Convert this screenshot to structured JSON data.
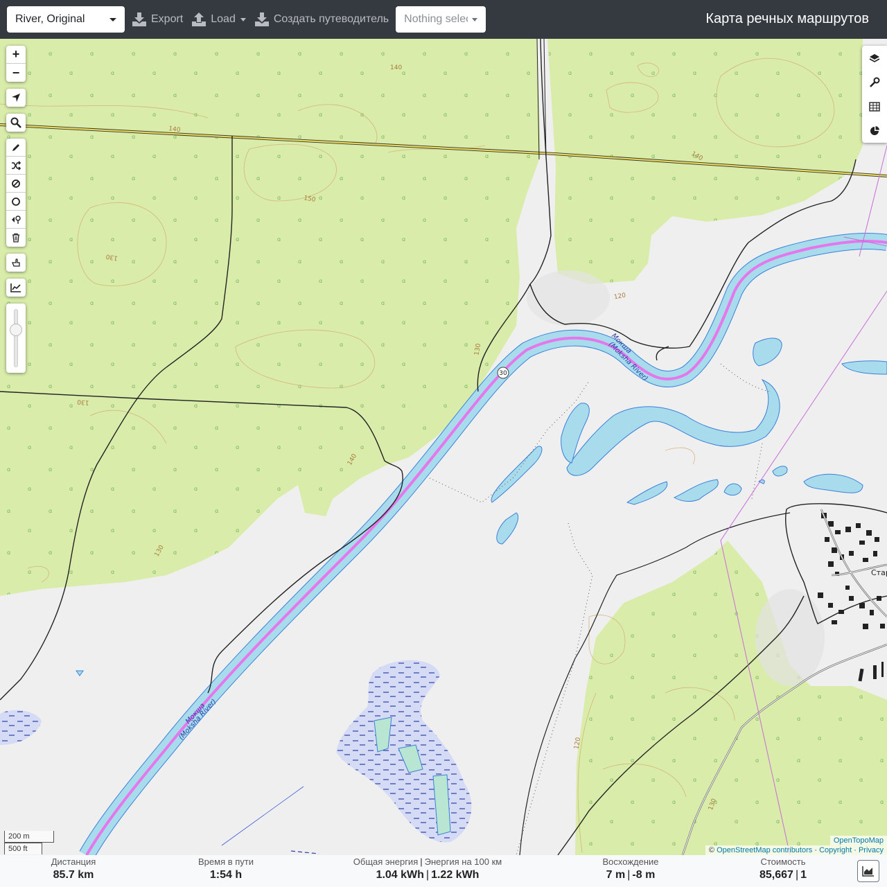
{
  "topbar": {
    "profile_value": "River, Original",
    "export_label": "Export",
    "load_label": "Load",
    "guide_label": "Создать путеводитель",
    "nothing_selected": "Nothing selected",
    "app_title": "Карта речных маршрутов"
  },
  "map": {
    "river_label_upper": "Мокша",
    "river_label_upper_sub": "(Moksha River)",
    "river_label_lower": "Мокша",
    "river_label_lower_sub": "(Moksha River)",
    "route_marker": "30",
    "contours": [
      "140",
      "140",
      "150",
      "130",
      "130",
      "130",
      "140",
      "130",
      "120",
      "120",
      "130",
      "140"
    ],
    "settlement_label": "Стар",
    "colors": {
      "forest": "#d9ecaa",
      "water": "#a8dcec",
      "route": "#e676ec",
      "river_edge": "#3b7fd9",
      "road_major": "#ead85a"
    }
  },
  "controls": {
    "zoom_in": "+",
    "zoom_out": "−"
  },
  "scale": {
    "metric": "200 m",
    "imperial": "500 ft"
  },
  "attribution": {
    "provider": "OpenTopoMap",
    "copyright_prefix": "©",
    "osm": "OpenStreetMap contributors",
    "copyright": "Copyright",
    "privacy": "Privacy",
    "sep": "·"
  },
  "stats": {
    "distance_label": "Дистанция",
    "distance_value": "85.7 km",
    "time_label": "Время в пути",
    "time_value": "1:54 h",
    "energy_label": "Общая энергия",
    "energy_per_label": "Энергия на 100 км",
    "energy_value": "1.04 kWh",
    "energy_per_value": "1.22 kWh",
    "ascent_label": "Восхождение",
    "ascent_value": "7 m",
    "descent_value": "-8 m",
    "cost_label": "Стоимость",
    "cost_value": "85,667",
    "cost_count": "1",
    "divider": "|"
  }
}
